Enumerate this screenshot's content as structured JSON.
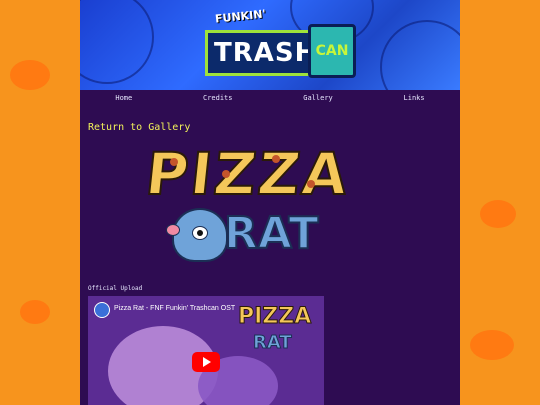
{
  "logo": {
    "funkin": "FUNKIN'",
    "trash": "TRASH",
    "can": "CAN"
  },
  "nav": {
    "home": "Home",
    "credits": "Credits",
    "gallery": "Gallery",
    "links": "Links"
  },
  "return_link": "Return to Gallery",
  "art": {
    "pizza": "PIZZA",
    "rat": "RAT"
  },
  "official_upload": "Official Upload",
  "video": {
    "title": "Pizza Rat - FNF Funkin' Trashcan OST",
    "thumb_pizza": "PIZZA",
    "thumb_rat": "RAT"
  },
  "colors": {
    "background": "#f7941d",
    "page": "#2e0c52",
    "link_yellow": "#f2f25a",
    "banner_blue": "#2f6bff"
  },
  "icons": {
    "play": "youtube-play-icon",
    "avatar": "channel-avatar-icon"
  }
}
